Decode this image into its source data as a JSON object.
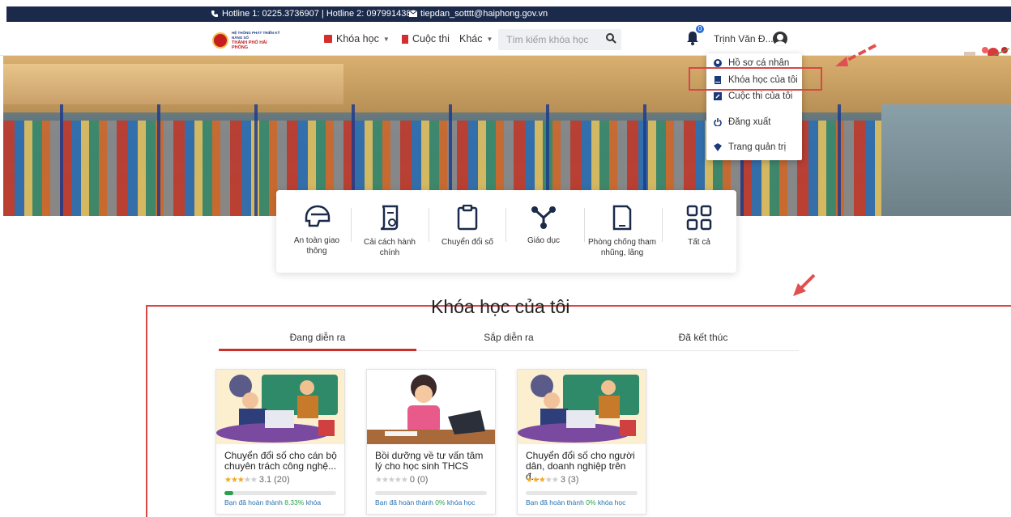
{
  "topbar": {
    "hotline": "Hotline 1: 0225.3736907 | Hotline 2: 0979914389",
    "email": "tiepdan_sotttt@haiphong.gov.vn"
  },
  "header": {
    "logo_line1": "HỆ THỐNG PHÁT TRIỂN KỸ NĂNG SỐ",
    "logo_line2": "THÀNH PHỐ HẢI PHÒNG",
    "nav_courses": "Khóa học",
    "nav_contests": "Cuộc thi",
    "nav_other": "Khác",
    "search_placeholder": "Tìm kiếm khóa học",
    "notification_count": "0",
    "user_name": "Trịnh Văn Đ..."
  },
  "user_menu": {
    "items": [
      {
        "label": "Hồ sơ cá nhân",
        "icon": "user-circle-icon"
      },
      {
        "label": "Khóa học của tôi",
        "icon": "book-icon"
      },
      {
        "label": "Cuộc thi của tôi",
        "icon": "edit-icon"
      },
      {
        "label": "Đăng xuất",
        "icon": "power-icon"
      },
      {
        "label": "Trang quản trị",
        "icon": "shield-icon"
      }
    ]
  },
  "categories": [
    {
      "label": "An toàn giao thông",
      "icon": "helmet-icon"
    },
    {
      "label": "Cải cách hành chính",
      "icon": "scroll-icon"
    },
    {
      "label": "Chuyển đổi số",
      "icon": "clipboard-icon"
    },
    {
      "label": "Giáo dục",
      "icon": "network-icon"
    },
    {
      "label": "Phòng chống tham nhũng, lãng",
      "icon": "phone-doc-icon"
    },
    {
      "label": "Tất cả",
      "icon": "grid-icon"
    }
  ],
  "my_courses": {
    "title": "Khóa học của tôi",
    "tabs": [
      "Đang diễn ra",
      "Sắp diễn ra",
      "Đã kết thúc"
    ],
    "active_tab": 0,
    "cards": [
      {
        "title": "Chuyển đổi số cho cán bộ chuyên trách công nghệ...",
        "rating": "3.1",
        "rating_count": "(20)",
        "stars": 3,
        "progress_prefix": "Bạn đã hoàn thành",
        "progress": "8.33%",
        "progress_suffix": "khóa",
        "progress_value": 8.33
      },
      {
        "title": "Bồi dưỡng về tư vấn tâm lý cho học sinh THCS",
        "rating": "0",
        "rating_count": "(0)",
        "stars": 0,
        "progress_prefix": "Bạn đã hoàn thành",
        "progress": "0%",
        "progress_suffix": "khóa học",
        "progress_value": 0
      },
      {
        "title": "Chuyển đổi số cho người dân, doanh nghiệp trên đ...",
        "rating": "3",
        "rating_count": "(3)",
        "stars": 3,
        "progress_prefix": "Bạn đã hoàn thành",
        "progress": "0%",
        "progress_suffix": "khóa học",
        "progress_value": 0
      }
    ]
  },
  "colors": {
    "accent_red": "#c9312b",
    "nav_dark": "#1b2a4a",
    "progress_green": "#2aa14b",
    "annotation_red": "#d94646"
  }
}
